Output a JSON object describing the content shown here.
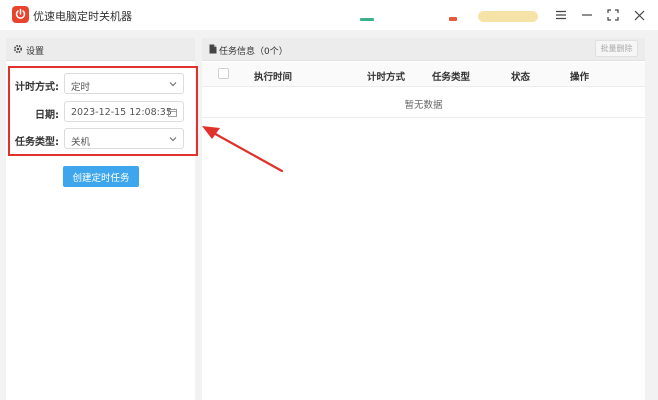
{
  "window": {
    "title": "优速电脑定时关机器",
    "controls": [
      "menu-icon",
      "minimize-icon",
      "maximize-icon",
      "close-icon"
    ]
  },
  "settings": {
    "header": "设置",
    "fields": [
      {
        "label": "计时方式:",
        "value": "定时",
        "type": "select"
      },
      {
        "label": "日期:",
        "value": "2023-12-15 12:08:35",
        "type": "datetime"
      },
      {
        "label": "任务类型:",
        "value": "关机",
        "type": "select"
      }
    ],
    "create_button": "创建定时任务"
  },
  "tasks": {
    "header": "任务信息（0个）",
    "batch_delete": "批量删除",
    "columns": [
      "执行时间",
      "计时方式",
      "任务类型",
      "状态",
      "操作"
    ],
    "empty_text": "暂无数据"
  },
  "colors": {
    "accent_blue": "#3ea6ec",
    "highlight_red": "#e0312b",
    "app_icon": "#e8432f"
  }
}
